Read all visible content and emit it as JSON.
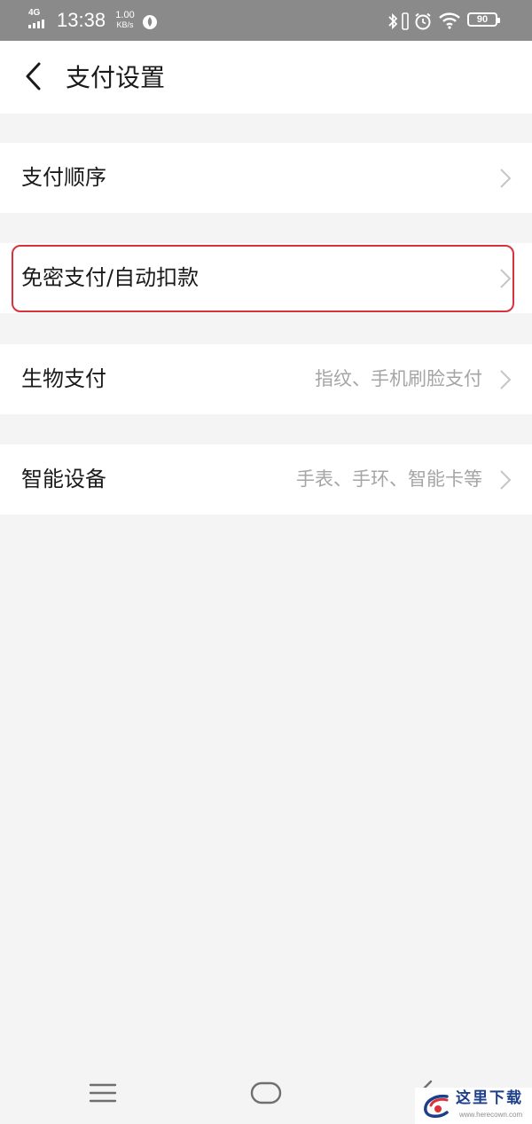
{
  "status_bar": {
    "network": "4G",
    "time": "13:38",
    "speed_value": "1.00",
    "speed_unit": "KB/s",
    "battery": "90",
    "icons": [
      "signal-icon",
      "flame-icon",
      "bluetooth-icon",
      "vibrate-icon",
      "alarm-icon",
      "wifi-icon",
      "battery-icon"
    ]
  },
  "header": {
    "title": "支付设置",
    "back_icon": "chevron-left-icon"
  },
  "settings": [
    {
      "label": "支付顺序",
      "value": ""
    },
    {
      "label": "免密支付/自动扣款",
      "value": "",
      "highlighted": true
    },
    {
      "label": "生物支付",
      "value": "指纹、手机刷脸支付"
    },
    {
      "label": "智能设备",
      "value": "手表、手环、智能卡等"
    }
  ],
  "colors": {
    "status_bar_bg": "#8a8a8a",
    "page_bg": "#f4f4f4",
    "row_bg": "#ffffff",
    "text_primary": "#1a1a1a",
    "text_secondary": "#a5a5a5",
    "highlight": "#d8323a"
  },
  "nav_bar": {
    "icons": [
      "menu-icon",
      "home-icon",
      "back-icon"
    ]
  },
  "watermark": {
    "text": "这里下载",
    "url": "www.herecown.com"
  }
}
